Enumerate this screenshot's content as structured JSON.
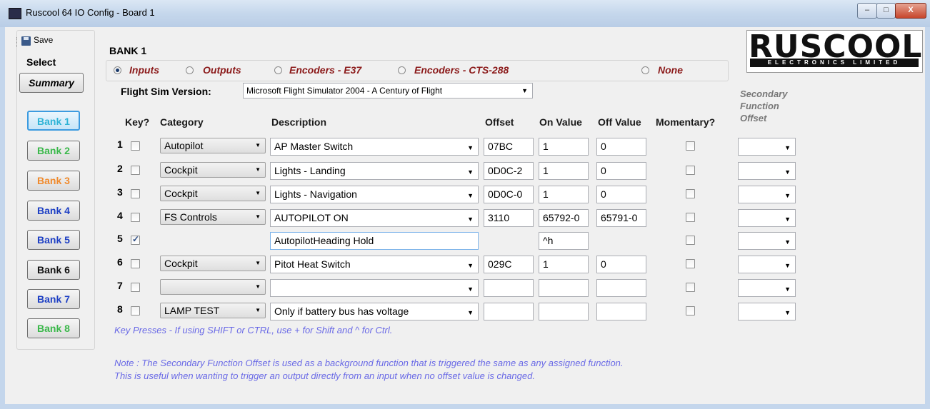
{
  "window": {
    "title": "Ruscool 64 IO Config - Board 1",
    "minimize": "–",
    "maximize": "□",
    "close": "X"
  },
  "toolbar": {
    "save_label": "Save"
  },
  "sidebar": {
    "select_label": "Select",
    "summary_label": "Summary",
    "banks": [
      {
        "label": "Bank 1",
        "color": "#2fb3d6",
        "active": true
      },
      {
        "label": "Bank 2",
        "color": "#3ab84a"
      },
      {
        "label": "Bank 3",
        "color": "#f08a2c"
      },
      {
        "label": "Bank 4",
        "color": "#1d3fc4"
      },
      {
        "label": "Bank 5",
        "color": "#1d3fc4"
      },
      {
        "label": "Bank 6",
        "color": "#111111"
      },
      {
        "label": "Bank 7",
        "color": "#1d3fc4"
      },
      {
        "label": "Bank 8",
        "color": "#3ab84a"
      }
    ]
  },
  "bank": {
    "title": "BANK 1",
    "modes": [
      {
        "label": "Inputs",
        "checked": true
      },
      {
        "label": "Outputs"
      },
      {
        "label": "Encoders - E37"
      },
      {
        "label": "Encoders - CTS-288"
      },
      {
        "label": "None"
      }
    ],
    "flight_sim_label": "Flight Sim Version:",
    "flight_sim_value": "Microsoft Flight Simulator 2004 - A Century of Flight"
  },
  "logo": {
    "main": "RUSCOOL",
    "sub": "ELECTRONICS LIMITED"
  },
  "table": {
    "headers": {
      "key": "Key?",
      "category": "Category",
      "description": "Description",
      "offset": "Offset",
      "on_value": "On Value",
      "off_value": "Off Value",
      "momentary": "Momentary?",
      "secondary_line1": "Secondary",
      "secondary_line2": "Function",
      "secondary_line3": "Offset"
    },
    "rows": [
      {
        "num": "1",
        "key": false,
        "category": "Autopilot",
        "description": "AP Master Switch",
        "offset": "07BC",
        "on": "1",
        "off": "0"
      },
      {
        "num": "2",
        "key": false,
        "category": "Cockpit",
        "description": "Lights - Landing",
        "offset": "0D0C-2",
        "on": "1",
        "off": "0"
      },
      {
        "num": "3",
        "key": false,
        "category": "Cockpit",
        "description": "Lights - Navigation",
        "offset": "0D0C-0",
        "on": "1",
        "off": "0"
      },
      {
        "num": "4",
        "key": false,
        "category": "FS Controls",
        "description": "AUTOPILOT ON",
        "offset": "3110",
        "on": "65792-0",
        "off": "65791-0"
      },
      {
        "num": "5",
        "key": true,
        "category": "",
        "description": "AutopilotHeading Hold",
        "offset": "",
        "on": "^h",
        "off": ""
      },
      {
        "num": "6",
        "key": false,
        "category": "Cockpit",
        "description": "Pitot Heat Switch",
        "offset": "029C",
        "on": "1",
        "off": "0"
      },
      {
        "num": "7",
        "key": false,
        "category": "",
        "description": "",
        "offset": "",
        "on": "",
        "off": ""
      },
      {
        "num": "8",
        "key": false,
        "category": "LAMP TEST",
        "description": "Only if battery bus has voltage",
        "offset": "",
        "on": "",
        "off": ""
      }
    ]
  },
  "hint": "Key Presses - If using SHIFT or CTRL, use + for Shift and ^ for Ctrl.",
  "note_line1": "Note : The Secondary Function Offset is used as a background function that is triggered the same as any assigned function.",
  "note_line2": "This is useful when wanting to trigger an output directly from an input when no offset value is changed.",
  "icons": {
    "arrow": "▼"
  }
}
